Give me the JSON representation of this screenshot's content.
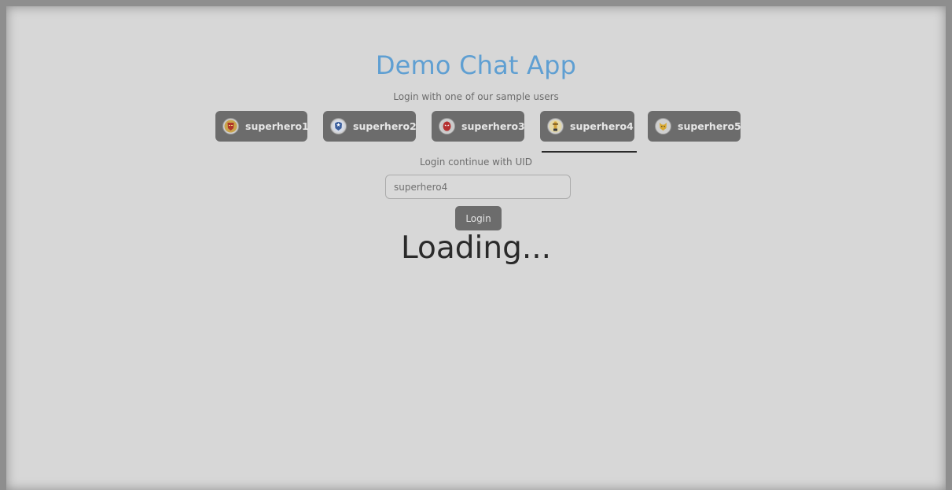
{
  "header": {
    "title": "Demo Chat App",
    "subtitle": "Login with one of our sample users"
  },
  "users": [
    {
      "label": "superhero1",
      "icon": "iron-man-avatar-icon"
    },
    {
      "label": "superhero2",
      "icon": "captain-america-avatar-icon"
    },
    {
      "label": "superhero3",
      "icon": "spider-man-avatar-icon"
    },
    {
      "label": "superhero4",
      "icon": "cyclops-avatar-icon",
      "selected": true
    },
    {
      "label": "superhero5",
      "icon": "wolverine-avatar-icon"
    }
  ],
  "uid_section": {
    "label": "Login continue with UID",
    "input_value": "superhero4",
    "login_label": "Login"
  },
  "status": {
    "loading_text": "Loading..."
  },
  "colors": {
    "background": "#d7d7d7",
    "title": "#5f9fd2",
    "button": "#6c6c6c",
    "button_text": "#e6e6e6"
  }
}
